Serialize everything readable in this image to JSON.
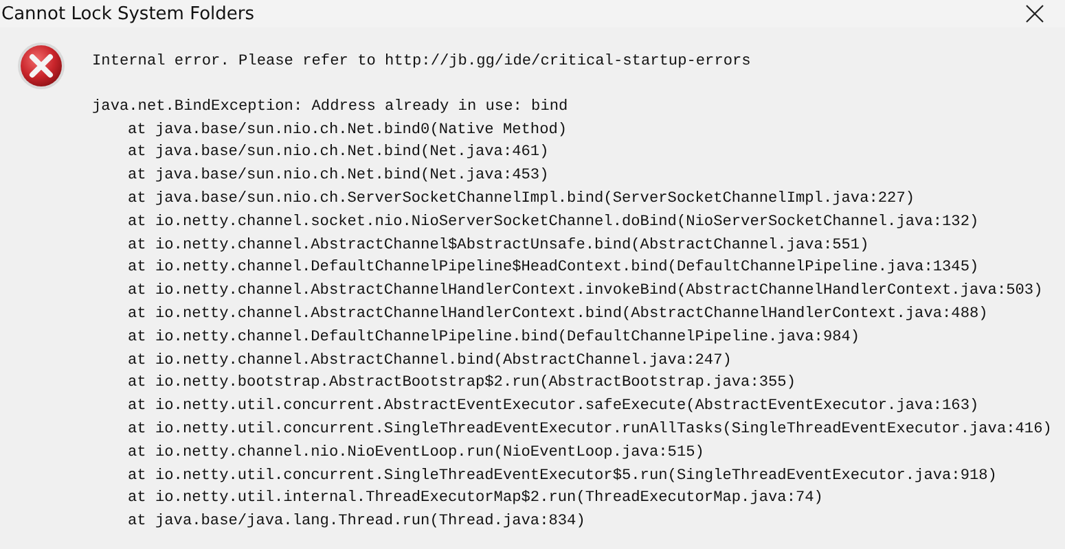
{
  "window": {
    "title": "Cannot Lock System Folders"
  },
  "message": "Internal error. Please refer to http://jb.gg/ide/critical-startup-errors",
  "exception": "java.net.BindException: Address already in use: bind",
  "stack_trace": [
    "at java.base/sun.nio.ch.Net.bind0(Native Method)",
    "at java.base/sun.nio.ch.Net.bind(Net.java:461)",
    "at java.base/sun.nio.ch.Net.bind(Net.java:453)",
    "at java.base/sun.nio.ch.ServerSocketChannelImpl.bind(ServerSocketChannelImpl.java:227)",
    "at io.netty.channel.socket.nio.NioServerSocketChannel.doBind(NioServerSocketChannel.java:132)",
    "at io.netty.channel.AbstractChannel$AbstractUnsafe.bind(AbstractChannel.java:551)",
    "at io.netty.channel.DefaultChannelPipeline$HeadContext.bind(DefaultChannelPipeline.java:1345)",
    "at io.netty.channel.AbstractChannelHandlerContext.invokeBind(AbstractChannelHandlerContext.java:503)",
    "at io.netty.channel.AbstractChannelHandlerContext.bind(AbstractChannelHandlerContext.java:488)",
    "at io.netty.channel.DefaultChannelPipeline.bind(DefaultChannelPipeline.java:984)",
    "at io.netty.channel.AbstractChannel.bind(AbstractChannel.java:247)",
    "at io.netty.bootstrap.AbstractBootstrap$2.run(AbstractBootstrap.java:355)",
    "at io.netty.util.concurrent.AbstractEventExecutor.safeExecute(AbstractEventExecutor.java:163)",
    "at io.netty.util.concurrent.SingleThreadEventExecutor.runAllTasks(SingleThreadEventExecutor.java:416)",
    "at io.netty.channel.nio.NioEventLoop.run(NioEventLoop.java:515)",
    "at io.netty.util.concurrent.SingleThreadEventExecutor$5.run(SingleThreadEventExecutor.java:918)",
    "at io.netty.util.internal.ThreadExecutorMap$2.run(ThreadExecutorMap.java:74)",
    "at java.base/java.lang.Thread.run(Thread.java:834)"
  ]
}
